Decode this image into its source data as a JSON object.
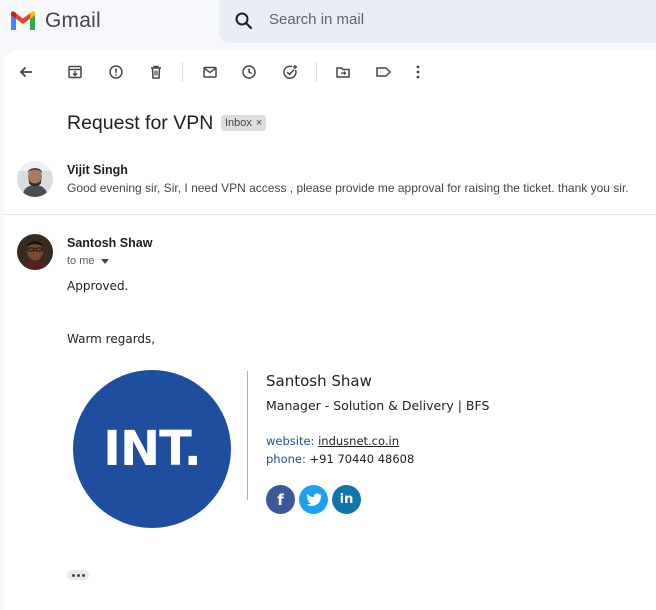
{
  "app": {
    "name": "Gmail"
  },
  "search": {
    "placeholder": "Search in mail"
  },
  "toolbar": {
    "icons": [
      "back-arrow-icon",
      "archive-icon",
      "report-spam-icon",
      "delete-icon",
      "mark-unread-icon",
      "snooze-icon",
      "add-task-icon",
      "move-to-icon",
      "label-icon",
      "more-vertical-icon"
    ]
  },
  "thread": {
    "subject": "Request for VPN",
    "label_chip": "Inbox",
    "label_chip_close": "×"
  },
  "messages": [
    {
      "sender": "Vijit Singh",
      "snippet": "Good evening sir, Sir, I need VPN access , please provide me approval for raising the ticket. thank you sir."
    },
    {
      "sender": "Santosh Shaw",
      "recipient": "to me",
      "body": [
        "Approved.",
        "Warm regards,"
      ]
    }
  ],
  "signature": {
    "logo_text": "INT.",
    "name": "Santosh Shaw",
    "title": "Manager - Solution & Delivery | BFS",
    "website_label": "website:",
    "website": "indusnet.co.in",
    "phone_label": "phone:",
    "phone": "+91 70440 48608",
    "social": [
      {
        "icon": "facebook-icon",
        "glyph": "f",
        "color": "#3b5998"
      },
      {
        "icon": "twitter-icon",
        "glyph": "t",
        "color": "#1da1f2"
      },
      {
        "icon": "linkedin-icon",
        "glyph": "in",
        "color": "#0e76a8"
      }
    ]
  },
  "colors": {
    "brand_blue": "#1f4e9e",
    "search_bg": "#e9eef6"
  }
}
